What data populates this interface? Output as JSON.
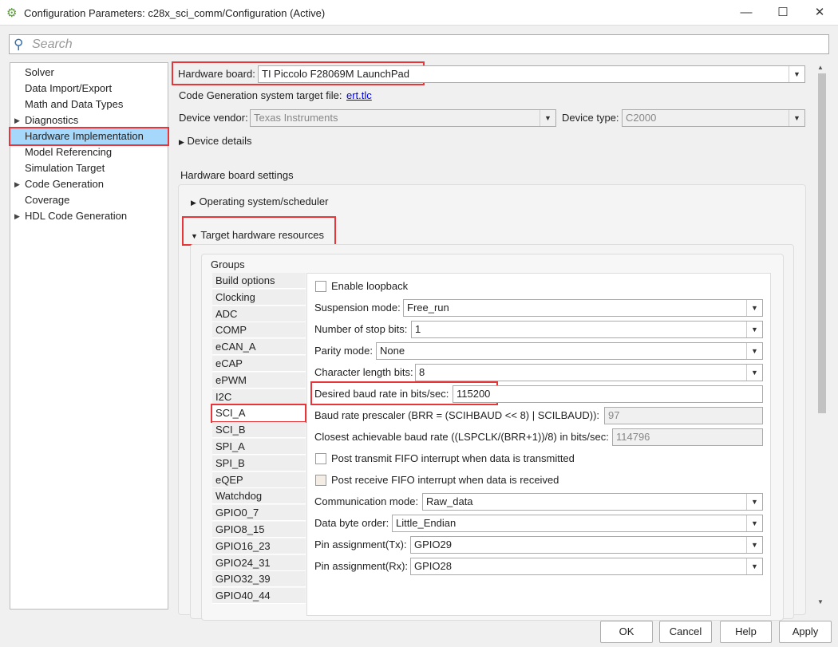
{
  "window": {
    "title": "Configuration Parameters: c28x_sci_comm/Configuration (Active)",
    "controls": [
      "—",
      "☐",
      "✕"
    ]
  },
  "search": {
    "placeholder": "Search"
  },
  "tree": [
    {
      "label": "Solver",
      "expandable": false
    },
    {
      "label": "Data Import/Export",
      "expandable": false
    },
    {
      "label": "Math and Data Types",
      "expandable": false
    },
    {
      "label": "Diagnostics",
      "expandable": true
    },
    {
      "label": "Hardware Implementation",
      "expandable": false,
      "selected": true
    },
    {
      "label": "Model Referencing",
      "expandable": false
    },
    {
      "label": "Simulation Target",
      "expandable": false
    },
    {
      "label": "Code Generation",
      "expandable": true
    },
    {
      "label": "Coverage",
      "expandable": false
    },
    {
      "label": "HDL Code Generation",
      "expandable": true
    }
  ],
  "main": {
    "hardware_board_label": "Hardware board:",
    "hardware_board": "TI Piccolo F28069M LaunchPad",
    "target_file_label": "Code Generation system target file:",
    "target_file": "ert.tlc",
    "vendor_label": "Device vendor:",
    "vendor": "Texas Instruments",
    "type_label": "Device type:",
    "type": "C2000",
    "device_details": "Device details",
    "board_settings": "Hardware board settings",
    "os_section": "Operating system/scheduler",
    "thr_section": "Target hardware resources",
    "groups_label": "Groups",
    "groups": [
      "Build options",
      "Clocking",
      "ADC",
      "COMP",
      "eCAN_A",
      "eCAP",
      "ePWM",
      "I2C",
      "SCI_A",
      "SCI_B",
      "SPI_A",
      "SPI_B",
      "eQEP",
      "Watchdog",
      "GPIO0_7",
      "GPIO8_15",
      "GPIO16_23",
      "GPIO24_31",
      "GPIO32_39",
      "GPIO40_44"
    ],
    "selected_group": "SCI_A",
    "sci": {
      "loopback": "Enable loopback",
      "suspension_label": "Suspension mode:",
      "suspension": "Free_run",
      "stop_label": "Number of stop bits:",
      "stop": "1",
      "parity_label": "Parity mode:",
      "parity": "None",
      "charlen_label": "Character length bits:",
      "charlen": "8",
      "baud_label": "Desired baud rate in bits/sec:",
      "baud": "115200",
      "brr_label": "Baud rate prescaler (BRR = (SCIHBAUD << 8) | SCILBAUD)):",
      "brr": "97",
      "closest_label": "Closest achievable baud rate ((LSPCLK/(BRR+1))/8) in bits/sec:",
      "closest": "114796",
      "tx_fifo": "Post transmit FIFO interrupt when data is transmitted",
      "rx_fifo": "Post receive FIFO interrupt when data is received",
      "comm_label": "Communication mode:",
      "comm": "Raw_data",
      "order_label": "Data byte order:",
      "order": "Little_Endian",
      "tx_label": "Pin assignment(Tx):",
      "tx": "GPIO29",
      "rx_label": "Pin assignment(Rx):",
      "rx": "GPIO28"
    }
  },
  "buttons": {
    "ok": "OK",
    "cancel": "Cancel",
    "help": "Help",
    "apply": "Apply"
  },
  "colors": {
    "highlight": "#e8353a",
    "selection": "#a6d8fb",
    "link": "#0000ee"
  }
}
